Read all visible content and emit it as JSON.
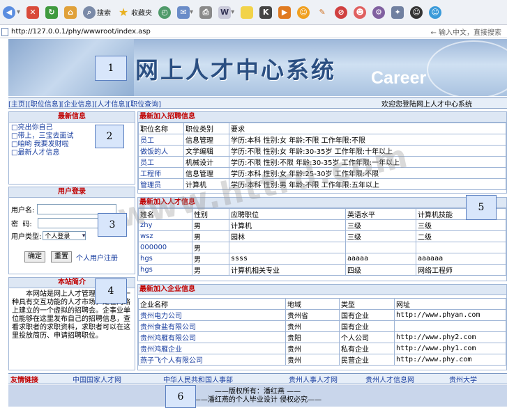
{
  "toolbar": {
    "search_label": "搜索",
    "favorites_label": "收藏夹"
  },
  "address": {
    "url": "http://127.0.0.1/phy/wwwroot/index.asp",
    "hint": "← 输入中文，直接搜索"
  },
  "banner": {
    "title": "网上人才中心系统",
    "career": "Career"
  },
  "nav": {
    "items": [
      "[主页]",
      "[职位信息]",
      "[企业信息]",
      "[人才信息]",
      "[职位查询]"
    ],
    "welcome": "欢迎您登陆网上人才中心系统"
  },
  "news": {
    "title": "最新信息",
    "items": [
      "□亮出你自己",
      "□带上，三宝去面试",
      "□咱哟 我要发财啦",
      "□最新人才信息"
    ]
  },
  "login": {
    "title": "用户登录",
    "username_label": "用户名:",
    "password_label": "密  码:",
    "type_label": "用户类型:",
    "type_value": "个人登录",
    "confirm_label": "确定",
    "reset_label": "重置",
    "register_label": "个人用户注册"
  },
  "intro": {
    "title": "本站简介",
    "text": "本网站是网上人才管理系统，是一种具有交互功能的人才市场，是在网络上建立的一个虚拟的招聘会。企事业单位能够在这里发布自己的招聘信息，查看求职者的求职资料，求职者可以在这里投放简历、申请招聘职位。"
  },
  "jobs": {
    "title": "最新加入招聘信息",
    "headers": [
      "职位名称",
      "职位类别",
      "要求"
    ],
    "rows": [
      [
        "员工",
        "信息管理",
        "学历:本科  性别:女  年龄:不限  工作年限:不限"
      ],
      [
        "做饭的人",
        "文学编辑",
        "学历:不限  性别:女  年龄:30-35岁  工作年限:十年以上"
      ],
      [
        "员工",
        "机械设计",
        "学历:不限  性别:不限  年龄:30-35岁  工作年限:一年以上"
      ],
      [
        "工程师",
        "信息管理",
        "学历:本科  性别:女  年龄:25-30岁  工作年限:不限"
      ],
      [
        "管理员",
        "计算机",
        "学历:本科  性别:男  年龄:不限  工作年限:五年以上"
      ]
    ]
  },
  "resumes": {
    "title": "最新加入人才信息",
    "headers": [
      "姓名",
      "性别",
      "应聘职位",
      "英语水平",
      "计算机技能"
    ],
    "rows": [
      [
        "zhy",
        "男",
        "计算机",
        "三级",
        "三级"
      ],
      [
        "wsz",
        "男",
        "园林",
        "三级",
        "二级"
      ],
      [
        "000000",
        "男",
        "",
        "",
        ""
      ],
      [
        "hgs",
        "男",
        "ssss",
        "aaaaa",
        "aaaaaa"
      ],
      [
        "hgs",
        "男",
        "计算机相关专业",
        "四级",
        "网络工程师"
      ]
    ]
  },
  "companies": {
    "title": "最新加入企业信息",
    "headers": [
      "企业名称",
      "地域",
      "类型",
      "网址"
    ],
    "rows": [
      [
        "贵州电力公司",
        "贵州省",
        "国有企业",
        "http://www.phyan.com"
      ],
      [
        "贵州食盐有限公司",
        "贵州",
        "国有企业",
        ""
      ],
      [
        "贵州鸿雁有限公司",
        "贵阳",
        "个人公司",
        "http://www.phy2.com"
      ],
      [
        "贵州鸿雁企业",
        "贵州",
        "私有企业",
        "http://www.phy1.com"
      ],
      [
        "燕子飞个人有限公司",
        "贵州",
        "民营企业",
        "http://www.phy.com"
      ]
    ]
  },
  "friends": {
    "label": "友情链接",
    "links": [
      "中国国家人才网",
      "中华人民共和国人事部",
      "贵州人事人才网",
      "贵州人才信息网",
      "贵州大学"
    ]
  },
  "footer": {
    "line1": "——版权所有：潘红燕 ——",
    "line2": "——潘红燕的个人毕业设计  侵权必究——"
  },
  "annotations": [
    "1",
    "2",
    "3",
    "4",
    "5",
    "6"
  ],
  "watermark": "www.httrd.com"
}
